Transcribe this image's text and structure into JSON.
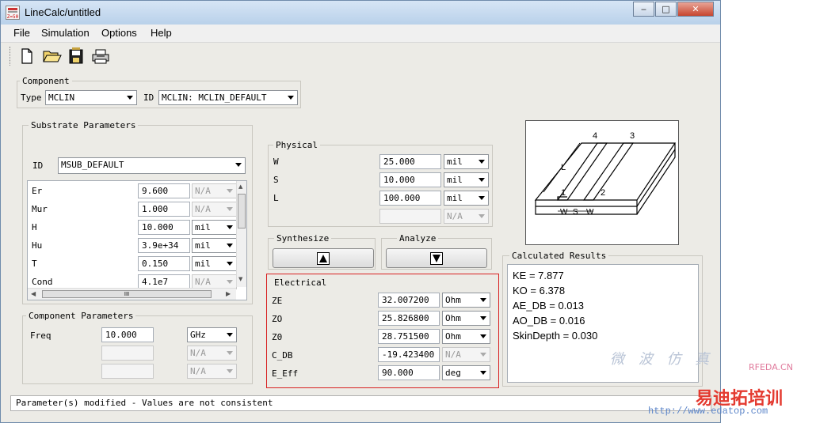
{
  "window": {
    "title": "LineCalc/untitled",
    "app_icon_text": "Z=50",
    "controls": {
      "minimize": "‒",
      "maximize": "□",
      "close": "✕"
    }
  },
  "menu": [
    "File",
    "Simulation",
    "Options",
    "Help"
  ],
  "toolbar": [
    "new-file-icon",
    "open-folder-icon",
    "save-icon",
    "print-icon"
  ],
  "component": {
    "label": "Component",
    "type_label": "Type",
    "type_value": "MCLIN",
    "id_label": "ID",
    "id_value": "MCLIN: MCLIN_DEFAULT"
  },
  "substrate": {
    "label": "Substrate Parameters",
    "id_label": "ID",
    "id_value": "MSUB_DEFAULT",
    "rows": [
      {
        "name": "Er",
        "value": "9.600",
        "unit": "N/A",
        "unit_enabled": false
      },
      {
        "name": "Mur",
        "value": "1.000",
        "unit": "N/A",
        "unit_enabled": false
      },
      {
        "name": "H",
        "value": "10.000",
        "unit": "mil",
        "unit_enabled": true
      },
      {
        "name": "Hu",
        "value": "3.9e+34",
        "unit": "mil",
        "unit_enabled": true
      },
      {
        "name": "T",
        "value": "0.150",
        "unit": "mil",
        "unit_enabled": true
      },
      {
        "name": "Cond",
        "value": "4.1e7",
        "unit": "N/A",
        "unit_enabled": false
      }
    ],
    "hscroll_thumb": "III"
  },
  "component_params": {
    "label": "Component Parameters",
    "rows": [
      {
        "name": "Freq",
        "value": "10.000",
        "unit": "GHz",
        "enabled": true
      },
      {
        "name": "",
        "value": "",
        "unit": "N/A",
        "enabled": false
      },
      {
        "name": "",
        "value": "",
        "unit": "N/A",
        "enabled": false
      }
    ]
  },
  "physical": {
    "label": "Physical",
    "rows": [
      {
        "name": "W",
        "value": "25.000",
        "unit": "mil",
        "enabled": true
      },
      {
        "name": "S",
        "value": "10.000",
        "unit": "mil",
        "enabled": true
      },
      {
        "name": "L",
        "value": "100.000",
        "unit": "mil",
        "enabled": true
      },
      {
        "name": "",
        "value": "",
        "unit": "N/A",
        "enabled": false
      }
    ]
  },
  "synthesize": {
    "label": "Synthesize"
  },
  "analyze": {
    "label": "Analyze"
  },
  "electrical": {
    "label": "Electrical",
    "rows": [
      {
        "name": "ZE",
        "value": "32.007200",
        "unit": "Ohm",
        "enabled": true
      },
      {
        "name": "ZO",
        "value": "25.826800",
        "unit": "Ohm",
        "enabled": true
      },
      {
        "name": "Z0",
        "value": "28.751500",
        "unit": "Ohm",
        "enabled": true
      },
      {
        "name": "C_DB",
        "value": "-19.423400",
        "unit": "N/A",
        "enabled": false
      },
      {
        "name": "E_Eff",
        "value": "90.000",
        "unit": "deg",
        "enabled": true
      }
    ]
  },
  "diagram": {
    "labels": [
      "L",
      "4",
      "3",
      "1",
      "2",
      "W",
      "S",
      "W"
    ]
  },
  "results": {
    "label": "Calculated Results",
    "lines": [
      "KE = 7.877",
      "KO = 6.378",
      "AE_DB = 0.013",
      "AO_DB = 0.016",
      "SkinDepth = 0.030"
    ]
  },
  "status": "Parameter(s) modified - Values are not consistent",
  "watermark": {
    "brand": "易迪拓培训",
    "url": "http://www.edatop.com",
    "site": "RFEDA.CN",
    "cn": "微 波 仿 真"
  },
  "colors": {
    "electrical_border": "#d82020",
    "titlebar": "#c4d8ee"
  }
}
